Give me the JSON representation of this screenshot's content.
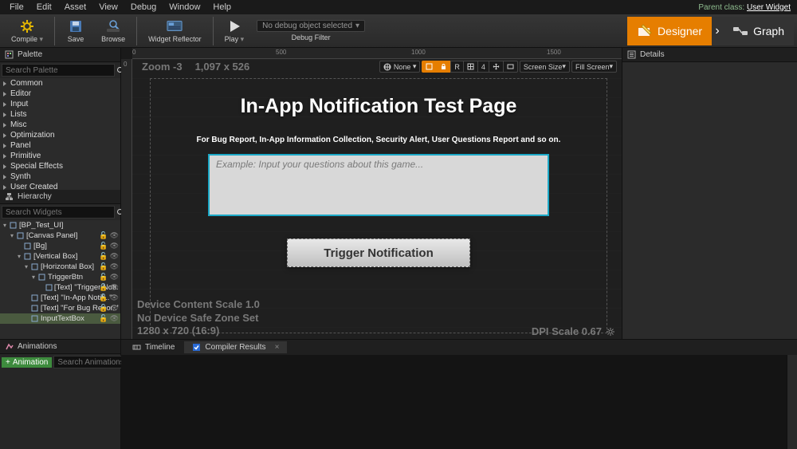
{
  "menu": [
    "File",
    "Edit",
    "Asset",
    "View",
    "Debug",
    "Window",
    "Help"
  ],
  "parent_class_label": "Parent class:",
  "parent_class_value": "User Widget",
  "toolbar": {
    "compile": "Compile",
    "save": "Save",
    "browse": "Browse",
    "reflector": "Widget Reflector",
    "play": "Play",
    "debug_obj": "No debug object selected",
    "debug_filter": "Debug Filter"
  },
  "modes": {
    "designer": "Designer",
    "graph": "Graph"
  },
  "palette": {
    "title": "Palette",
    "search_ph": "Search Palette",
    "groups": [
      "Common",
      "Editor",
      "Input",
      "Lists",
      "Misc",
      "Optimization",
      "Panel",
      "Primitive",
      "Special Effects",
      "Synth",
      "User Created"
    ]
  },
  "hierarchy": {
    "title": "Hierarchy",
    "search_ph": "Search Widgets",
    "items": [
      {
        "d": 0,
        "exp": "▾",
        "ico": "root",
        "t": "[BP_Test_UI]"
      },
      {
        "d": 1,
        "exp": "▾",
        "ico": "canvas",
        "t": "[Canvas Panel]",
        "vis": true
      },
      {
        "d": 2,
        "exp": "",
        "ico": "img",
        "t": "[Bg]",
        "vis": true
      },
      {
        "d": 2,
        "exp": "▾",
        "ico": "vbox",
        "t": "[Vertical Box]",
        "vis": true
      },
      {
        "d": 3,
        "exp": "▾",
        "ico": "hbox",
        "t": "[Horizontal Box]",
        "vis": true
      },
      {
        "d": 4,
        "exp": "▾",
        "ico": "btn",
        "t": "TriggerBtn",
        "vis": true
      },
      {
        "d": 5,
        "exp": "",
        "ico": "txt",
        "t": "[Text] \"Trigger Noti..\"",
        "vis": true
      },
      {
        "d": 3,
        "exp": "",
        "ico": "txt",
        "t": "[Text] \"In-App Notifi..\"",
        "vis": true
      },
      {
        "d": 3,
        "exp": "",
        "ico": "txt",
        "t": "[Text] \"For Bug Repor..\"",
        "vis": true
      },
      {
        "d": 3,
        "exp": "",
        "ico": "input",
        "t": "InputTextBox",
        "vis": true,
        "sel": true
      }
    ]
  },
  "canvas": {
    "zoom": "Zoom -3",
    "dims": "1,097 x 526",
    "rulers_h": [
      {
        "p": 0,
        "v": "0"
      },
      {
        "p": 180,
        "v": "500"
      },
      {
        "p": 350,
        "v": "1000"
      },
      {
        "p": 520,
        "v": "1500"
      }
    ],
    "ruler_v": [
      {
        "p": 0,
        "v": "0"
      }
    ],
    "toolbar": {
      "none": "None",
      "r": "R",
      "num": "4",
      "ss": "Screen Size",
      "fs": "Fill Screen"
    },
    "design": {
      "title": "In-App Notification Test Page",
      "sub": "For Bug Report, In-App Information Collection, Security Alert,  User Questions Report and so on.",
      "input_ph": "Example: Input your questions about this game...",
      "btn": "Trigger Notification"
    },
    "footer": {
      "l1": "Device Content Scale 1.0",
      "l2": "No Device Safe Zone Set",
      "l3": "1280 x 720 (16:9)",
      "dpi": "DPI Scale 0.67"
    }
  },
  "details": {
    "title": "Details"
  },
  "animations": {
    "title": "Animations",
    "add": "Animation",
    "search_ph": "Search Animations"
  },
  "output": {
    "timeline": "Timeline",
    "compiler": "Compiler Results"
  }
}
